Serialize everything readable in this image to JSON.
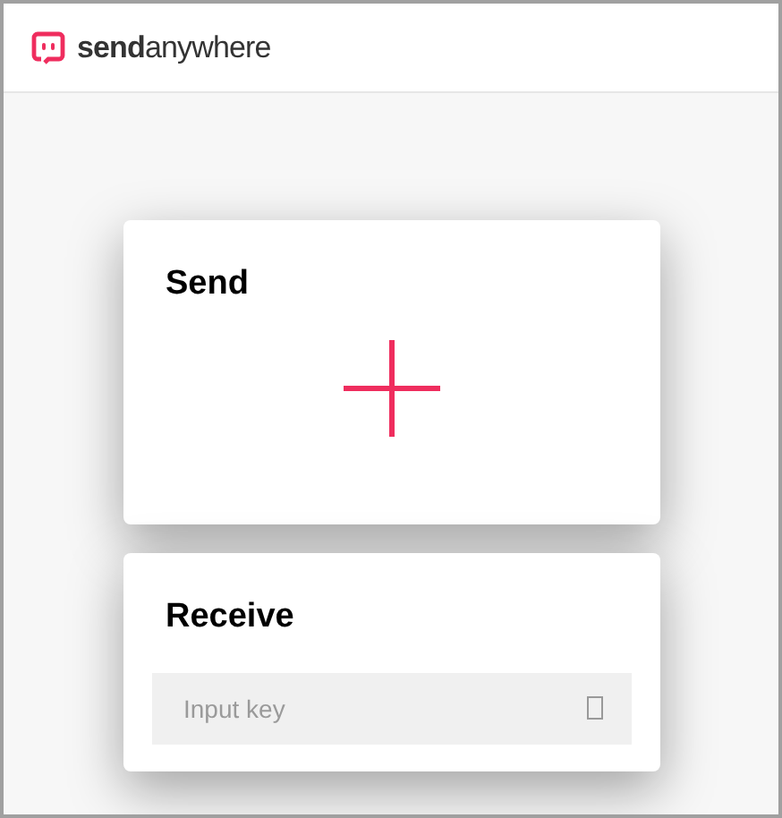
{
  "header": {
    "logo_text": "**send**anywhere"
  },
  "send_card": {
    "title": "Send"
  },
  "receive_card": {
    "title": "Receive",
    "key_field": {
      "placeholder": "Input key"
    }
  }
}
